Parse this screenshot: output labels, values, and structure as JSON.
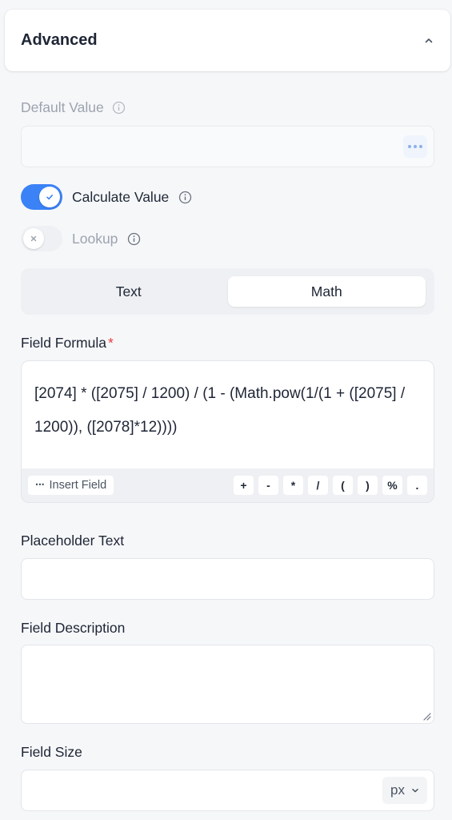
{
  "section": {
    "title": "Advanced"
  },
  "default_value": {
    "label": "Default Value",
    "value": ""
  },
  "calculate_value": {
    "label": "Calculate Value",
    "enabled": true
  },
  "lookup": {
    "label": "Lookup",
    "enabled": false
  },
  "calc_mode": {
    "options": [
      "Text",
      "Math"
    ],
    "selected": "Math"
  },
  "field_formula": {
    "label": "Field Formula",
    "required_mark": "*",
    "value": "[2074] * ([2075] / 1200) / (1 - (Math.pow(1/(1 + ([2075] / 1200)), ([2078]*12))))",
    "insert_field_label": "Insert Field",
    "operators": [
      "+",
      "-",
      "*",
      "/",
      "(",
      ")",
      "%",
      "."
    ]
  },
  "placeholder_text": {
    "label": "Placeholder Text",
    "value": ""
  },
  "field_description": {
    "label": "Field Description",
    "value": ""
  },
  "field_size": {
    "label": "Field Size",
    "value": "",
    "unit": "px"
  },
  "colors": {
    "accent": "#3b82f6",
    "required": "#e53e3e",
    "muted_text": "#9ca3af"
  }
}
